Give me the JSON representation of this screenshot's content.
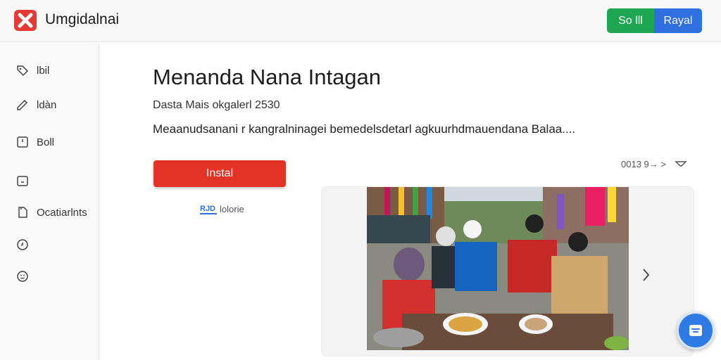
{
  "header": {
    "app_title": "Umgidalnai",
    "logo_icon": "x-logo-icon",
    "primary_button_label": "So lll",
    "secondary_button_label": "Rayal",
    "colors": {
      "logo": "#e53935",
      "green": "#1fa653",
      "blue": "#2f6fe0"
    }
  },
  "sidebar": {
    "items": [
      {
        "label": "lbil",
        "icon": "tag-icon"
      },
      {
        "label": "ldàn",
        "icon": "edit-icon"
      },
      {
        "label": "Boll",
        "icon": "window-icon"
      },
      {
        "label": "",
        "icon": "calendar-icon"
      },
      {
        "label": "Ocatiarlnts",
        "icon": "document-icon"
      },
      {
        "label": "",
        "icon": "clock-icon"
      },
      {
        "label": "",
        "icon": "smiley-icon"
      }
    ]
  },
  "main": {
    "title": "Menanda Nana Intagan",
    "meta": "Dasta Mais okgalerl 2530",
    "description": "Meaanudsanani r kangralninagei bemedelsdetarl agkuurhdmauendana Balaa....",
    "install_label": "Instal",
    "install_color": "#e53227",
    "sub_badge": "RJD",
    "sub_link": "lolorie",
    "size_info": "0013 9→ >",
    "filter_icon": "filter-icon"
  },
  "gallery": {
    "next_icon": "chevron-right-icon"
  },
  "fab": {
    "icon": "inbox-icon",
    "color": "#2e7be6"
  }
}
